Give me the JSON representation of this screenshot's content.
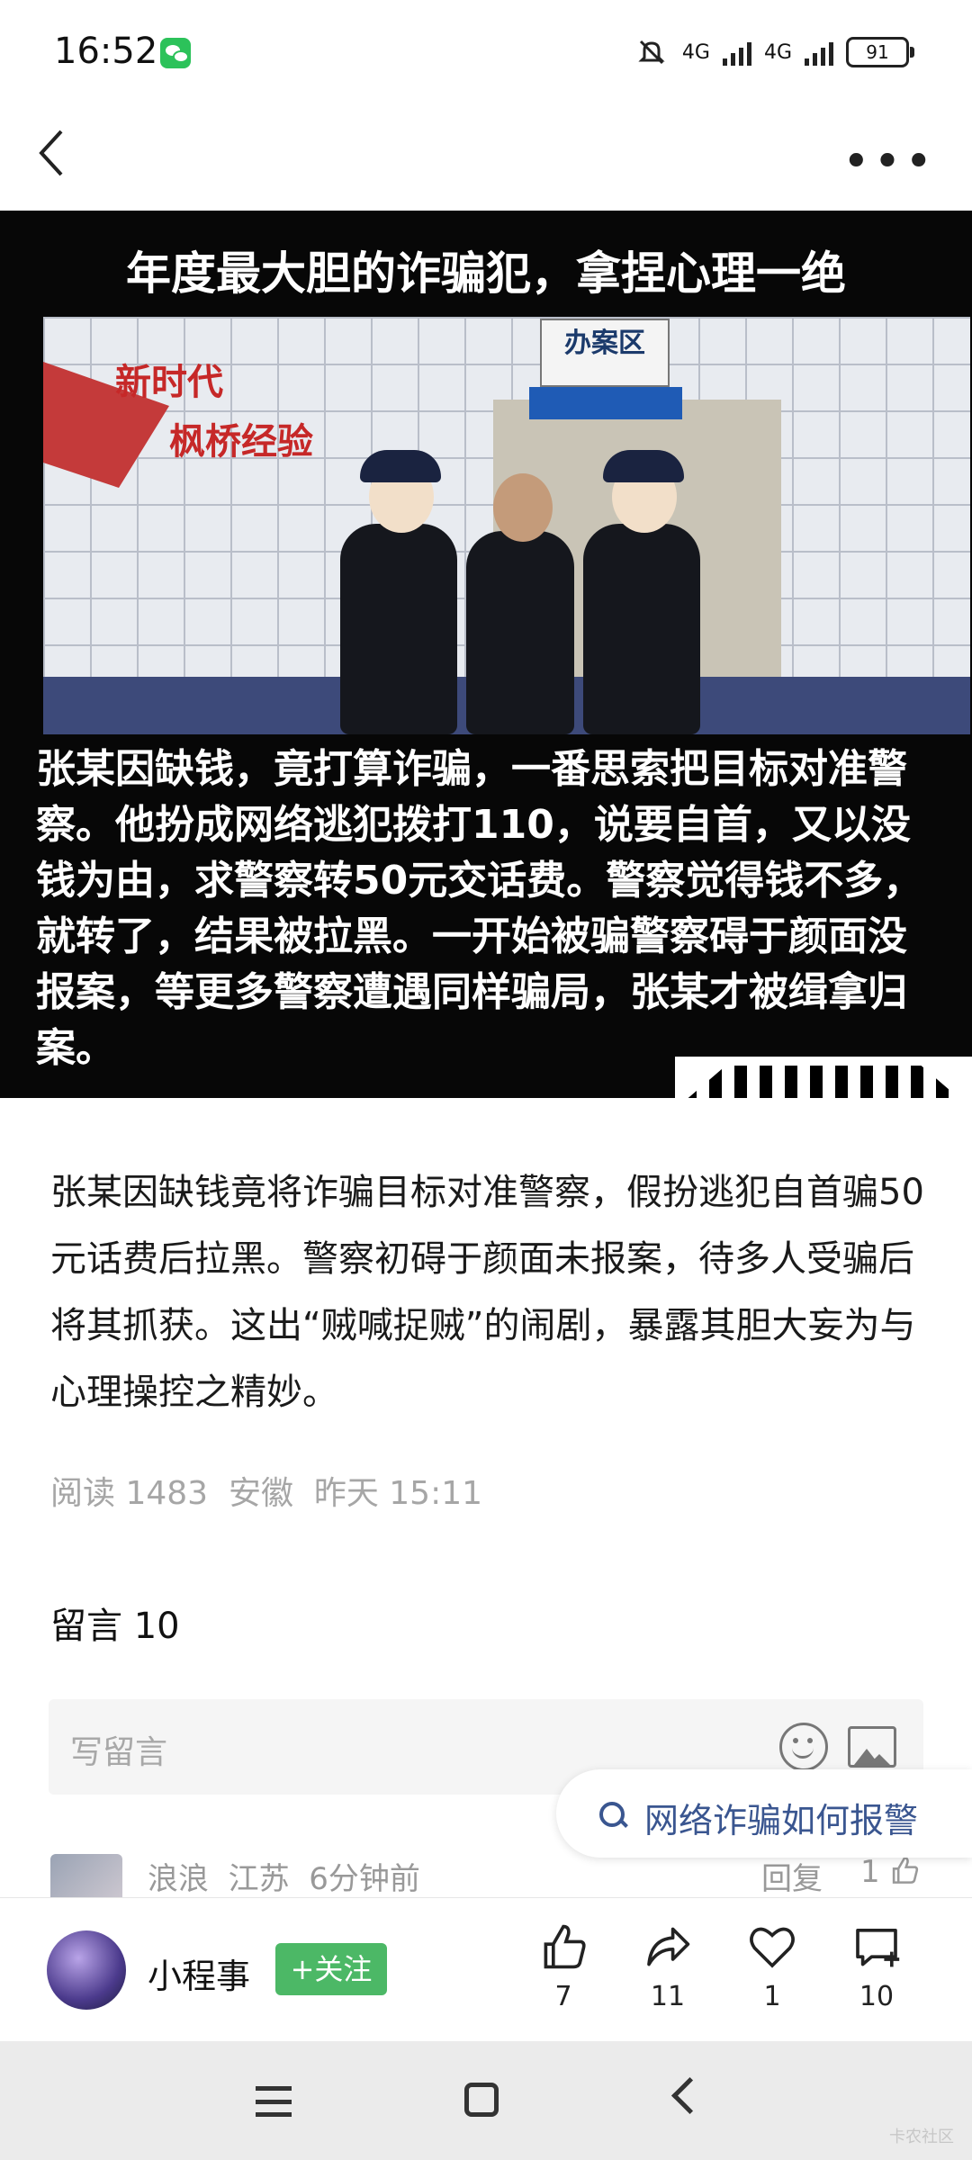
{
  "status_bar": {
    "time": "16:52",
    "network1": "4G",
    "network2": "4G",
    "battery": "91"
  },
  "hero": {
    "title": "年度最大胆的诈骗犯，拿捏心理一绝",
    "slogan_line1": "新时代",
    "slogan_line2": "枫桥经验",
    "office_sign": "办案区",
    "caption": "张某因缺钱，竟打算诈骗，一番思索把目标对准警察。他扮成网络逃犯拨打110，说要自首，又以没钱为由，求警察转50元交话费。警察觉得钱不多，就转了，结果被拉黑。一开始被骗警察碍于颜面没报案，等更多警察遭遇同样骗局，张某才被缉拿归案。"
  },
  "article": {
    "body": "张某因缺钱竟将诈骗目标对准警察，假扮逃犯自首骗50元话费后拉黑。警察初碍于颜面未报案，待多人受骗后将其抓获。这出“贼喊捉贼”的闹剧，暴露其胆大妄为与心理操控之精妙。",
    "meta": "阅读 1483  安徽  昨天 15:11"
  },
  "comments": {
    "title": "留言 10",
    "input_placeholder": "写留言",
    "first": {
      "meta": "浪浪  江苏  6分钟前",
      "reply_label": "回复",
      "likes": "1"
    }
  },
  "search_suggestion": "网络诈骗如何报警",
  "author": {
    "name": "小程事",
    "follow_label": "+关注"
  },
  "actions": {
    "like_count": "7",
    "share_count": "11",
    "favorite_count": "1",
    "comment_count": "10"
  },
  "watermark": "卡农社区",
  "icons": [
    "back-icon",
    "more-icon",
    "emoji-icon",
    "image-icon",
    "search-icon",
    "like-icon",
    "share-icon",
    "heart-icon",
    "comment-icon",
    "menu-icon",
    "home-icon",
    "nav-back-icon"
  ]
}
